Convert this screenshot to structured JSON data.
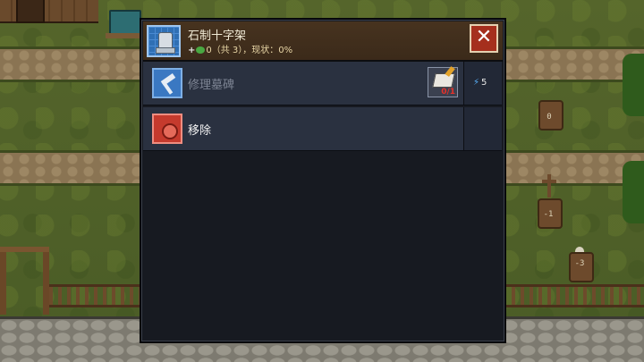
{
  "panel": {
    "title": "石制十字架",
    "quality_plus": "+",
    "quality_text": "0（共 3），现状：0%"
  },
  "actions": [
    {
      "label": "修理墓碑",
      "enabled": false,
      "cost_count": "0/1",
      "energy": "5"
    },
    {
      "label": "移除",
      "enabled": true
    }
  ],
  "world": {
    "grave_numbers": [
      "0",
      "-1",
      "-3"
    ]
  },
  "icons": {
    "close": "✕",
    "energy": "⚡"
  },
  "colors": {
    "panel_bg": "#171a21",
    "row_bg": "#2a3140",
    "header_bg": "#3b2a1a",
    "close_button": "#a52f1d",
    "repair_icon": "#3a78c2",
    "remove_icon": "#c53a2d",
    "cost_count": "#e6312a"
  }
}
